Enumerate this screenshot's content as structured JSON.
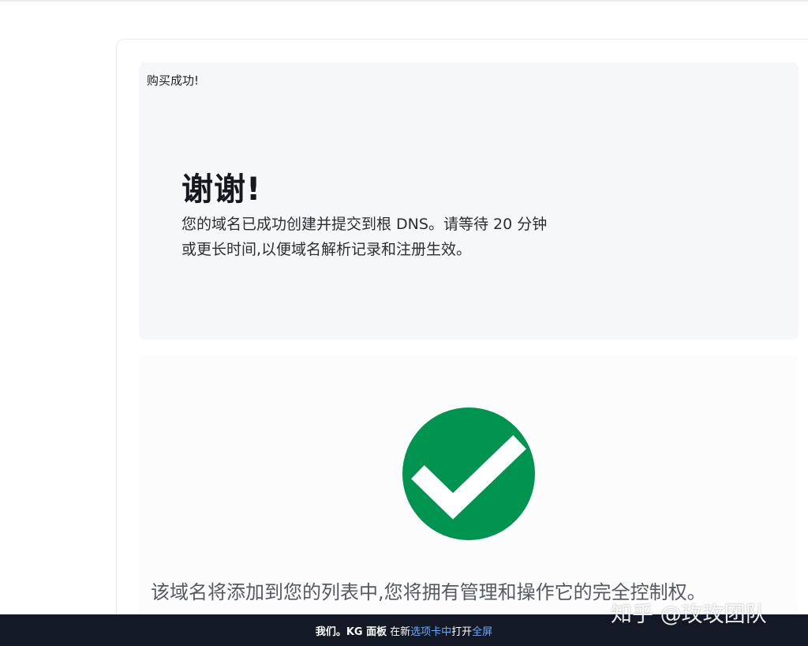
{
  "header": {
    "label": "购买成功!"
  },
  "thanks": {
    "title": "谢谢!",
    "message": "您的域名已成功创建并提交到根 DNS。请等待 20 分钟或更长时间,以便域名解析记录和注册生效。"
  },
  "status": {
    "icon": "check-circle-icon",
    "icon_color": "#009451",
    "message": "该域名将添加到您的列表中,您将拥有管理和操作它的完全控制权。"
  },
  "watermark": "知乎 @玫玫团队",
  "bottom_bar": {
    "brand": "我们。KG 面板",
    "text_1": "在新",
    "link_tab": "选项卡中",
    "text_2": "打开",
    "link_fullscreen": "全屏"
  }
}
